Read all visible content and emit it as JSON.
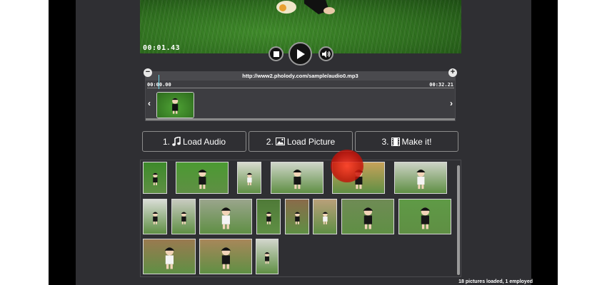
{
  "video": {
    "time": "00:01.43"
  },
  "timeline": {
    "url": "http://www2.pholody.com/sample/audio0.mp3",
    "start_time": "00:00.00",
    "end_time": "00:32.21"
  },
  "actions": {
    "load_audio": "1.♫ Load Audio",
    "load_audio_text": "Load Audio",
    "load_audio_num": "1.",
    "load_picture_num": "2.",
    "load_picture_text": "Load Picture",
    "make_num": "3.",
    "make_text": "Make it!"
  },
  "gallery": {
    "status": "18 pictures loaded, 1 employed"
  },
  "icons": [
    "stop-icon",
    "play-icon",
    "volume-icon",
    "music-note-icon",
    "picture-icon",
    "film-icon",
    "minus-icon",
    "plus-icon",
    "chevron-left-icon",
    "chevron-right-icon"
  ]
}
